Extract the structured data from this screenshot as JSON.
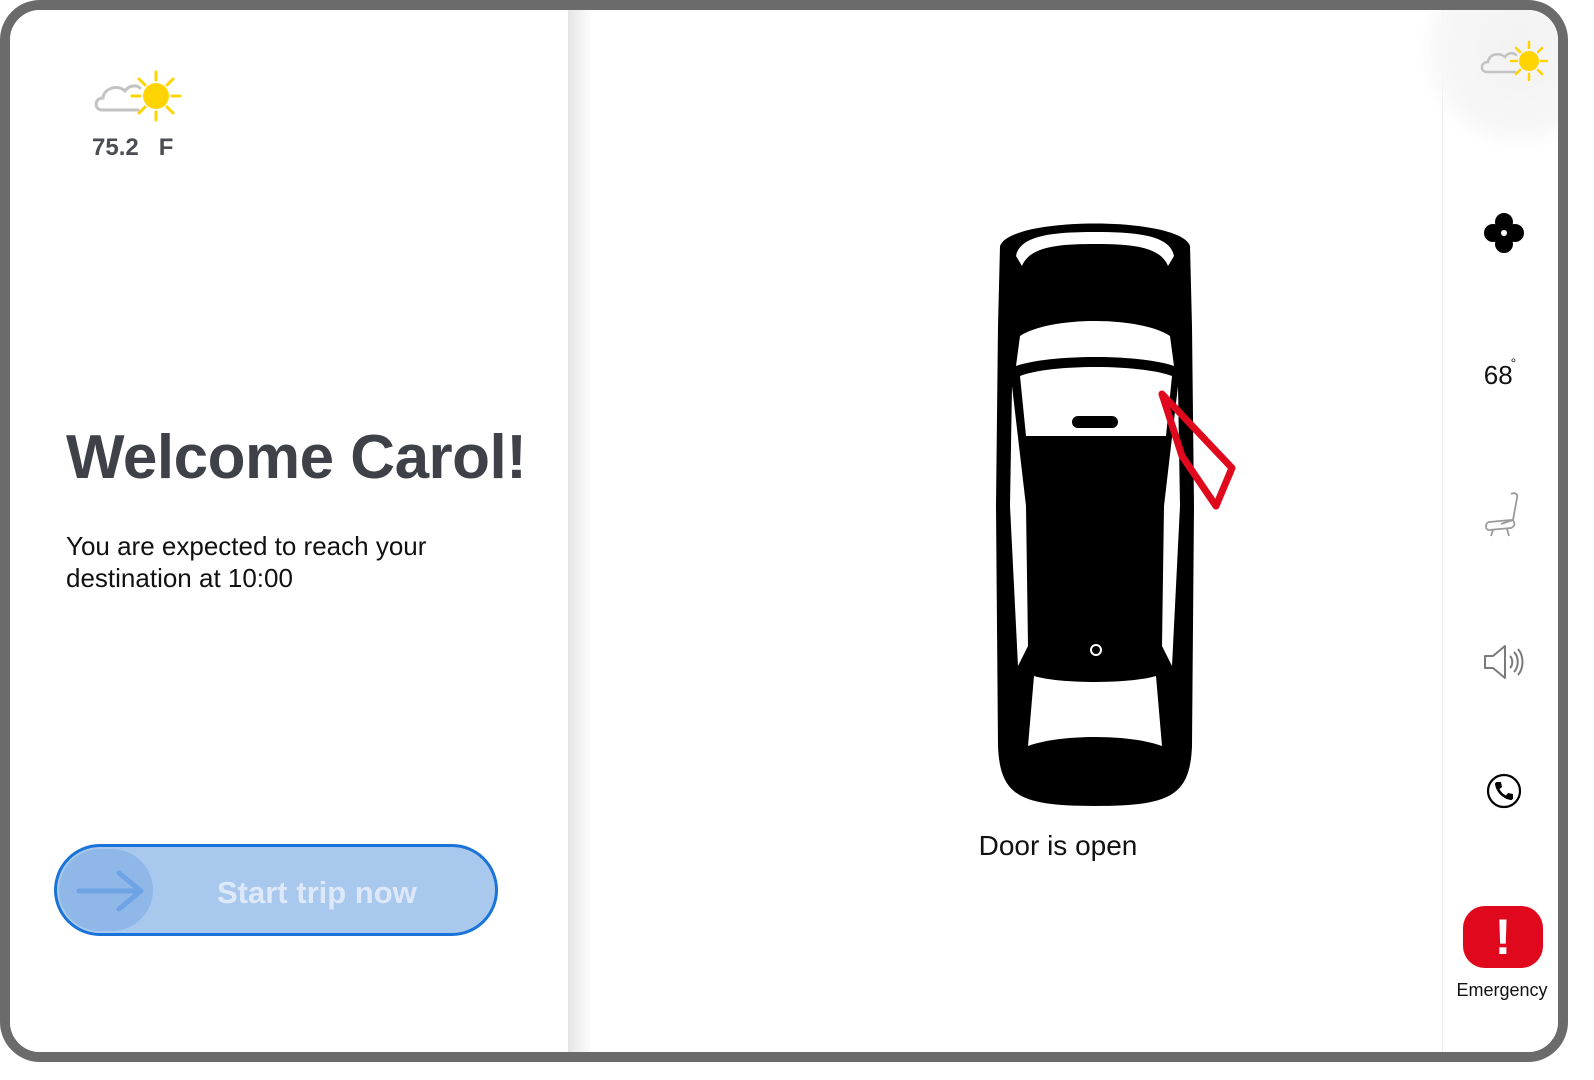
{
  "weather": {
    "temperature": "75.2",
    "unit": "F",
    "icon": "partly-sunny-icon"
  },
  "greeting": {
    "title": "Welcome Carol!"
  },
  "eta": {
    "line1": "You are expected to reach your",
    "line2": "destination at  10:00"
  },
  "start_trip": {
    "label": "Start trip now",
    "icon": "arrow-right-icon"
  },
  "vehicle": {
    "status": "Door is open",
    "open_door_color": "#e0081c"
  },
  "rail": {
    "weather_icon": "partly-sunny-icon",
    "fan_icon": "fan-icon",
    "temperature": "68",
    "degree": "°",
    "seat_icon": "seat-icon",
    "volume_icon": "speaker-icon",
    "phone_icon": "phone-icon",
    "emergency": {
      "label": "Emergency",
      "symbol": "!",
      "color": "#e0081c"
    }
  },
  "colors": {
    "accent": "#1a73d8",
    "accent_fill": "#a9c8ee",
    "heading": "#3e4147"
  }
}
